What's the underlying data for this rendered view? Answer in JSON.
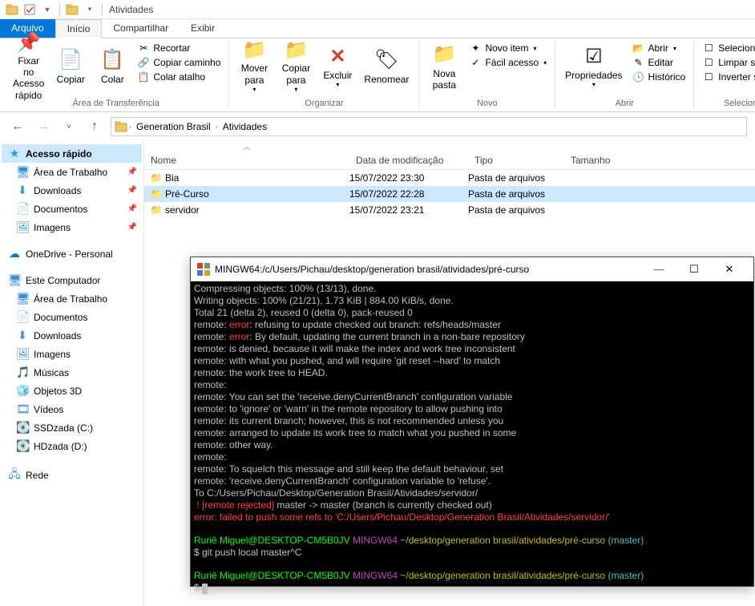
{
  "qat": {
    "title": "Atividades"
  },
  "tabs": {
    "file": "Arquivo",
    "home": "Início",
    "share": "Compartilhar",
    "view": "Exibir"
  },
  "ribbon": {
    "pin": "Fixar no\nAcesso rápido",
    "copy": "Copiar",
    "paste": "Colar",
    "cut": "Recortar",
    "copypath": "Copiar caminho",
    "pasteshortcut": "Colar atalho",
    "clipboard_label": "Área de Transferência",
    "moveto": "Mover\npara",
    "copyto": "Copiar\npara",
    "delete": "Excluir",
    "rename": "Renomear",
    "organize_label": "Organizar",
    "newfolder": "Nova\npasta",
    "newitem": "Novo item",
    "easyaccess": "Fácil acesso",
    "new_label": "Novo",
    "properties": "Propriedades",
    "open": "Abrir",
    "edit": "Editar",
    "history": "Histórico",
    "open_label": "Abrir",
    "selectall": "Selecionar tudo",
    "selectnone": "Limpar seleção",
    "invert": "Inverter seleção",
    "select_label": "Selecionar"
  },
  "breadcrumb": {
    "p1": "Generation Brasil",
    "p2": "Atividades"
  },
  "nav": {
    "quick": "Acesso rápido",
    "desktop": "Área de Trabalho",
    "downloads": "Downloads",
    "documents": "Documentos",
    "images": "Imagens",
    "onedrive": "OneDrive - Personal",
    "thispc": "Este Computador",
    "desktop2": "Área de Trabalho",
    "documents2": "Documentos",
    "downloads2": "Downloads",
    "images2": "Imagens",
    "music": "Músicas",
    "objects3d": "Objetos 3D",
    "videos": "Vídeos",
    "ssd": "SSDzada (C:)",
    "hd": "HDzada (D:)",
    "network": "Rede"
  },
  "columns": {
    "name": "Nome",
    "date": "Data de modificação",
    "type": "Tipo",
    "size": "Tamanho"
  },
  "rows": [
    {
      "name": "Bia",
      "date": "15/07/2022 23:30",
      "type": "Pasta de arquivos"
    },
    {
      "name": "Pré-Curso",
      "date": "15/07/2022 22:28",
      "type": "Pasta de arquivos"
    },
    {
      "name": "servidor",
      "date": "15/07/2022 23:21",
      "type": "Pasta de arquivos"
    }
  ],
  "terminal": {
    "title": "MINGW64:/c/Users/Pichau/desktop/generation brasil/atividades/pré-curso",
    "l1": "Compressing objects: 100% (13/13), done.",
    "l2": "Writing objects: 100% (21/21), 1.73 KiB | 884.00 KiB/s, done.",
    "l3": "Total 21 (delta 2), reused 0 (delta 0), pack-reused 0",
    "l4a": "remote: ",
    "l4b": "error",
    "l4c": ": refusing to update checked out branch: refs/heads/master",
    "l5a": "remote: ",
    "l5b": "error",
    "l5c": ": By default, updating the current branch in a non-bare repository",
    "l6": "remote: is denied, because it will make the index and work tree inconsistent",
    "l7": "remote: with what you pushed, and will require 'git reset --hard' to match",
    "l8": "remote: the work tree to HEAD.",
    "l9": "remote:",
    "l10": "remote: You can set the 'receive.denyCurrentBranch' configuration variable",
    "l11": "remote: to 'ignore' or 'warn' in the remote repository to allow pushing into",
    "l12": "remote: its current branch; however, this is not recommended unless you",
    "l13": "remote: arranged to update its work tree to match what you pushed in some",
    "l14": "remote: other way.",
    "l15": "remote:",
    "l16": "remote: To squelch this message and still keep the default behaviour, set",
    "l17": "remote: 'receive.denyCurrentBranch' configuration variable to 'refuse'.",
    "l18": "To C:/Users/Pichau/Desktop/Generation Brasil/Atividades/servidor/",
    "l19a": " ! [remote rejected]",
    "l19b": " master -> master (branch is currently checked out)",
    "l20a": "error: failed to push some refs to ",
    "l20b": "'C:/Users/Pichau/Desktop/Generation Brasil/Atividades/servidor/'",
    "p1_user": "Ruriê Miguel@DESKTOP-CM5B0JV",
    "p1_sys": " MINGW64",
    "p1_path": " ~/desktop/generation brasil/atividades/pré-curso",
    "p1_branch": " (master)",
    "cmd1": "$ git push local master^C",
    "cmd2": "$ "
  }
}
